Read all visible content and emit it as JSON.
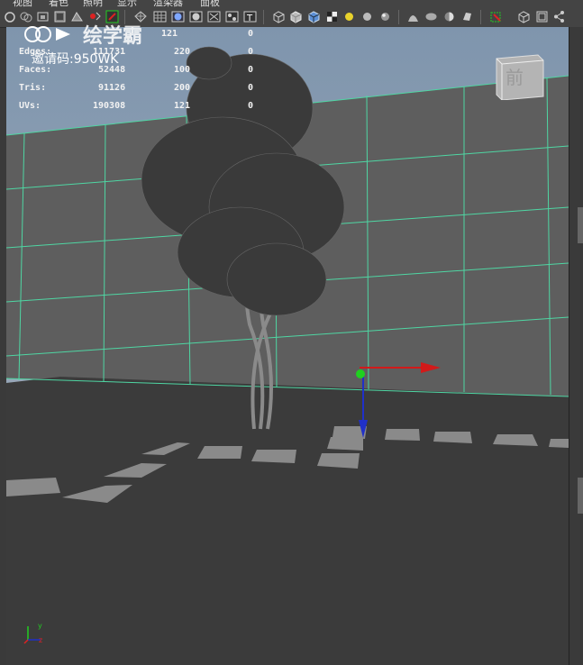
{
  "menu": {
    "items": [
      "视图",
      "着色",
      "照明",
      "显示",
      "渲染器",
      "面板"
    ]
  },
  "hud": {
    "rows": [
      {
        "label": "",
        "v1": "121",
        "v2": "0"
      },
      {
        "label": "Edges:",
        "v1": "111731",
        "v2": "220",
        "v3": "0"
      },
      {
        "label": "Faces:",
        "v1": "52448",
        "v2": "100",
        "v3": "0"
      },
      {
        "label": "Tris:",
        "v1": "91126",
        "v2": "200",
        "v3": "0"
      },
      {
        "label": "UVs:",
        "v1": "190308",
        "v2": "121",
        "v3": "0"
      }
    ],
    "top_row_v2": "0"
  },
  "watermark": {
    "logo_text": "绘学霸",
    "invite_code": "邀请码:950WK"
  },
  "viewcube": {
    "face_label": "前"
  },
  "axis": {
    "y_label": "y",
    "z_label": "z"
  },
  "colors": {
    "grid_line": "#4fd6a3",
    "sky_top": "#7f95ad",
    "sky_bottom": "#a9b4bf",
    "wall": "#5f5f5f",
    "floor": "#3c3c3c",
    "tile": "#8a8a8a",
    "manip_red": "#d21a1a",
    "manip_blue": "#2030c8",
    "manip_green": "#1fd11f",
    "tree": "#3a3a3a"
  }
}
